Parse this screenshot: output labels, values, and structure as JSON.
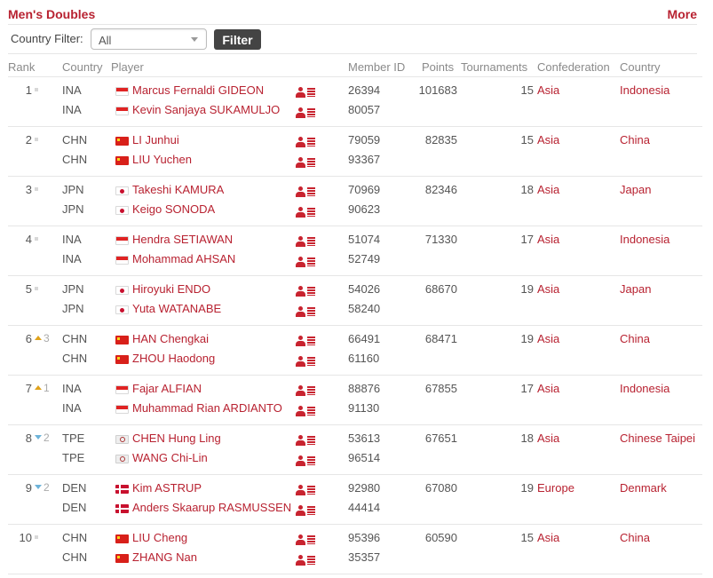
{
  "header": {
    "title": "Men's Doubles",
    "more_label": "More"
  },
  "filter": {
    "label": "Country Filter:",
    "selected": "All",
    "button_label": "Filter"
  },
  "columns": {
    "rank": "Rank",
    "country": "Country",
    "player": "Player",
    "member_id": "Member ID",
    "points": "Points",
    "tournaments": "Tournaments",
    "confederation": "Confederation",
    "country_name": "Country"
  },
  "colors": {
    "accent": "#b82231",
    "button_bg": "#444444",
    "rank_up": "#e0a21b",
    "rank_down": "#6db3d9",
    "divider": "#e6e6e6"
  },
  "rows": [
    {
      "rank": "1",
      "movement": "none",
      "change": "",
      "points": "101683",
      "tournaments": "15",
      "confederation": "Asia",
      "country": "Indonesia",
      "players": [
        {
          "code": "INA",
          "flag": "ina",
          "name": "Marcus Fernaldi GIDEON",
          "member_id": "26394",
          "icon": "player-profile-icon"
        },
        {
          "code": "INA",
          "flag": "ina",
          "name": "Kevin Sanjaya SUKAMULJO",
          "member_id": "80057",
          "icon": "player-profile-icon"
        }
      ]
    },
    {
      "rank": "2",
      "movement": "none",
      "change": "",
      "points": "82835",
      "tournaments": "15",
      "confederation": "Asia",
      "country": "China",
      "players": [
        {
          "code": "CHN",
          "flag": "chn",
          "name": "LI Junhui",
          "member_id": "79059",
          "icon": "player-profile-icon"
        },
        {
          "code": "CHN",
          "flag": "chn",
          "name": "LIU Yuchen",
          "member_id": "93367",
          "icon": "player-profile-icon"
        }
      ]
    },
    {
      "rank": "3",
      "movement": "none",
      "change": "",
      "points": "82346",
      "tournaments": "18",
      "confederation": "Asia",
      "country": "Japan",
      "players": [
        {
          "code": "JPN",
          "flag": "jpn",
          "name": "Takeshi KAMURA",
          "member_id": "70969",
          "icon": "player-profile-icon"
        },
        {
          "code": "JPN",
          "flag": "jpn",
          "name": "Keigo SONODA",
          "member_id": "90623",
          "icon": "player-profile-icon"
        }
      ]
    },
    {
      "rank": "4",
      "movement": "none",
      "change": "",
      "points": "71330",
      "tournaments": "17",
      "confederation": "Asia",
      "country": "Indonesia",
      "players": [
        {
          "code": "INA",
          "flag": "ina",
          "name": "Hendra SETIAWAN",
          "member_id": "51074",
          "icon": "player-profile-icon"
        },
        {
          "code": "INA",
          "flag": "ina",
          "name": "Mohammad AHSAN",
          "member_id": "52749",
          "icon": "player-profile-icon"
        }
      ]
    },
    {
      "rank": "5",
      "movement": "none",
      "change": "",
      "points": "68670",
      "tournaments": "19",
      "confederation": "Asia",
      "country": "Japan",
      "players": [
        {
          "code": "JPN",
          "flag": "jpn",
          "name": "Hiroyuki ENDO",
          "member_id": "54026",
          "icon": "player-profile-icon"
        },
        {
          "code": "JPN",
          "flag": "jpn",
          "name": "Yuta WATANABE",
          "member_id": "58240",
          "icon": "player-profile-icon"
        }
      ]
    },
    {
      "rank": "6",
      "movement": "up",
      "change": "3",
      "points": "68471",
      "tournaments": "19",
      "confederation": "Asia",
      "country": "China",
      "players": [
        {
          "code": "CHN",
          "flag": "chn",
          "name": "HAN Chengkai",
          "member_id": "66491",
          "icon": "player-profile-icon"
        },
        {
          "code": "CHN",
          "flag": "chn",
          "name": "ZHOU Haodong",
          "member_id": "61160",
          "icon": "player-profile-icon"
        }
      ]
    },
    {
      "rank": "7",
      "movement": "up",
      "change": "1",
      "points": "67855",
      "tournaments": "17",
      "confederation": "Asia",
      "country": "Indonesia",
      "players": [
        {
          "code": "INA",
          "flag": "ina",
          "name": "Fajar ALFIAN",
          "member_id": "88876",
          "icon": "player-profile-icon"
        },
        {
          "code": "INA",
          "flag": "ina",
          "name": "Muhammad Rian ARDIANTO",
          "member_id": "91130",
          "icon": "player-profile-icon"
        }
      ]
    },
    {
      "rank": "8",
      "movement": "down",
      "change": "2",
      "points": "67651",
      "tournaments": "18",
      "confederation": "Asia",
      "country": "Chinese Taipei",
      "players": [
        {
          "code": "TPE",
          "flag": "tpe",
          "name": "CHEN Hung Ling",
          "member_id": "53613",
          "icon": "player-profile-icon"
        },
        {
          "code": "TPE",
          "flag": "tpe",
          "name": "WANG Chi-Lin",
          "member_id": "96514",
          "icon": "player-profile-icon"
        }
      ]
    },
    {
      "rank": "9",
      "movement": "down",
      "change": "2",
      "points": "67080",
      "tournaments": "19",
      "confederation": "Europe",
      "country": "Denmark",
      "players": [
        {
          "code": "DEN",
          "flag": "den",
          "name": "Kim ASTRUP",
          "member_id": "92980",
          "icon": "player-profile-icon"
        },
        {
          "code": "DEN",
          "flag": "den",
          "name": "Anders Skaarup RASMUSSEN",
          "member_id": "44414",
          "icon": "player-profile-icon"
        }
      ]
    },
    {
      "rank": "10",
      "movement": "none",
      "change": "",
      "points": "60590",
      "tournaments": "15",
      "confederation": "Asia",
      "country": "China",
      "players": [
        {
          "code": "CHN",
          "flag": "chn",
          "name": "LIU Cheng",
          "member_id": "95396",
          "icon": "player-profile-icon"
        },
        {
          "code": "CHN",
          "flag": "chn",
          "name": "ZHANG Nan",
          "member_id": "35357",
          "icon": "player-profile-icon"
        }
      ]
    }
  ]
}
